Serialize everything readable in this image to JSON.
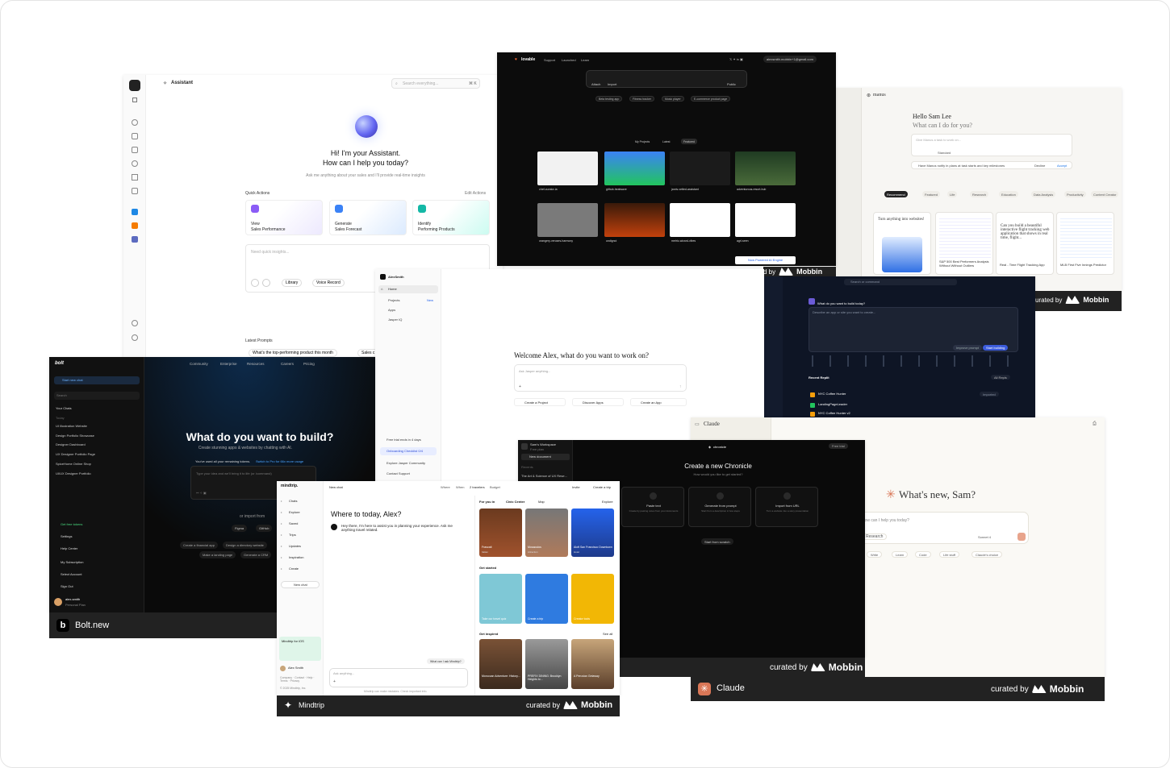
{
  "assistant": {
    "title": "Assistant",
    "search_placeholder": "Search everything...",
    "shortcut": "⌘ K",
    "greeting_line1": "Hi! I'm your Assistant.",
    "greeting_line2": "How can I help you today?",
    "subtitle": "Ask me anything about your sales and I'll provide real-time insights",
    "quick_actions_label": "Quick Actions",
    "edit_actions": "Edit Actions",
    "actions": [
      {
        "line1": "View",
        "line2": "Sales Performance"
      },
      {
        "line1": "Generate",
        "line2": "Sales Forecast"
      },
      {
        "line1": "Identify",
        "line2": "Performing Products"
      }
    ],
    "input_placeholder": "Need quick insights...",
    "library_label": "Library",
    "voice_label": "Voice Record",
    "latest_prompts_label": "Latest Prompts",
    "prompt_1": "What's the top-performing product this month",
    "prompt_2": "Sales c"
  },
  "lovable": {
    "brand": "lovable",
    "nav": [
      "Support",
      "Launched",
      "Learn"
    ],
    "email": "alexsmith.mobbin+1@gmail.com",
    "attach": "Attach",
    "import": "Import",
    "public": "Public",
    "suggestions": [
      "Beta testing app",
      "Fitness tracker",
      "Music player",
      "E-commerce product page"
    ],
    "tabs": [
      "My Projects",
      "Latest",
      "Featured"
    ],
    "projects_row1": [
      "chef-curator-ia",
      "github-heatwave",
      "jarvis-vetted-assistant",
      "adventurous-resort-hub"
    ],
    "projects_row2": [
      "orangery-veruses-harmony",
      "undignoi",
      "metric-wizard-vibes",
      "agri-seen"
    ],
    "more_label": "Now Powered AI Engine"
  },
  "manus": {
    "brand": "manus",
    "hello": "Hello Sam Lee",
    "question": "What can I do for you?",
    "input_placeholder": "Give Manus a task to work on...",
    "standard": "Standard",
    "suggestion": "Have Manus notify in plans at task starts and key milestones",
    "decline": "Decline",
    "accept": "Accept",
    "tabs": [
      "Recommend",
      "Featured",
      "Life",
      "Research",
      "Education",
      "Data Analysis",
      "Productivity",
      "Content Creator"
    ],
    "card1": "Turn anything into websites!",
    "card3": "Can you build a beautiful interactive flight tracking web application that shows in real time, flight...",
    "cap1": "S&P 500 Best Performers Analysis Without Without Outliers",
    "cap2": "Real - Time Flight Tracking App",
    "cap3": "MLB First Five Innings Predictor"
  },
  "jasper": {
    "user": "AlexSmith",
    "nav": [
      "Home",
      "Projects",
      "Apps",
      "Jasper IQ"
    ],
    "new_badge": "New",
    "welcome": "Welcome Alex, what do you want to work on?",
    "input_placeholder": "Ask Jasper anything...",
    "create_project": "Create a Project",
    "discover_apps": "Discover Apps",
    "create_app": "Create an App",
    "trial": "Free trial ends in 4 days",
    "checklist": "Onboarding Checklist 0/4",
    "explore": "Explore Jasper Community",
    "contact": "Contact Support"
  },
  "darkapp": {
    "search": "Search or command",
    "heading": "What do you want to build today?",
    "prompt": "Describe an app or site you want to create...",
    "improve": "Improve prompt",
    "start": "Start building",
    "recent_label": "Recent Replit",
    "recent_badge": "All Repls",
    "items": [
      "NYC Coffee Hunter",
      "LandingPageLeader",
      "NYC Coffee Hunter v2"
    ],
    "imported": "Imported"
  },
  "bolt": {
    "brand": "bolt",
    "start_chat": "Start new chat",
    "search": "Search",
    "your_chats": "Your Chats",
    "today": "Today",
    "chats": [
      "UI Illustration Website",
      "Design Portfolio Showcase",
      "Designer Dashboard",
      "UX Designer Portfolio Page",
      "SpiceHome Online Shop",
      "UI/UX Designer Portfolio"
    ],
    "nav": [
      "Community",
      "Enterprise",
      "Resources",
      "Careers",
      "Pricing"
    ],
    "heading": "What do you want to build?",
    "subheading": "Create stunning apps & websites by chatting with AI.",
    "tokens_notice": "You've used all your remaining tokens.",
    "tokens_link": "Switch to Pro for 66x more usage",
    "input_placeholder": "Type your idea and we'll bring it to life (or /command)",
    "import_from": "or import from",
    "figma": "Figma",
    "github": "GitHub",
    "suggestions": [
      "Create a financial app",
      "Design a directory website",
      "Make a landing page",
      "Generate a CRM"
    ],
    "menu": [
      "Get free tokens",
      "Settings",
      "Help Center",
      "My Subscription",
      "Select Account",
      "Sign Out"
    ],
    "user_name": "alex-smith",
    "user_plan": "Personal Plan",
    "footer": "Bolt.new"
  },
  "mindtrip": {
    "brand": "mindtrip.",
    "new_chat_title": "New chat",
    "filters": [
      "Where",
      "When",
      "2 travelers",
      "Budget"
    ],
    "invite": "Invite",
    "create_trip": "Create a trip",
    "nav": [
      "Chats",
      "Explore",
      "Saved",
      "Trips",
      "Updates",
      "Inspiration",
      "Create"
    ],
    "new_chat": "New chat",
    "heading": "Where to today, Alex?",
    "message": "Hey there, I'm here to assist you in planning your experience. Ask me anything travel related.",
    "ask_placeholder": "Ask anything...",
    "what_can": "What can I ask Mindtrip?",
    "disclaimer": "Mindtrip can make mistakes. Check important info.",
    "for_you": "For you in",
    "location": "Civic Center",
    "map": "Map",
    "explore": "Explore",
    "get_started": "Get started",
    "get_inspired": "Get inspired",
    "see_all": "See all",
    "places": [
      {
        "name": "Frascati",
        "sub": "Italian"
      },
      {
        "name": "Mosaoulos",
        "sub": "Attraction"
      },
      {
        "name": "Aloft San Francisco Downtown",
        "sub": "Hotel"
      }
    ],
    "started": [
      "Take our travel quiz",
      "Create a trip",
      "Creator tools"
    ],
    "inspired": [
      "Moroccan Adventure: History...",
      "PREFIX DINING: Brooklyn Heights to...",
      "A Peruvian Getaway"
    ],
    "promo": "Mindtrip for iOS",
    "user_name": "Alex Smith",
    "footer_links": "Company · Contact · Help · Terms · Privacy",
    "copyright": "© 2025 Mindtrip, Inc.",
    "footer": "Mindtrip"
  },
  "chronicle": {
    "workspace": "Sam's Workspace",
    "workspace_sub": "Free plan",
    "new_document": "New document",
    "section": "Recents",
    "doc": "The Art & Science of UX Rese...",
    "brand": "chronicle",
    "free_trial": "Free trial",
    "heading": "Create a new Chronicle",
    "subheading": "How would you like to get started?",
    "options": [
      {
        "title": "Paste text",
        "desc": "Create by pasting notes from your documents"
      },
      {
        "title": "Generate from prompt",
        "desc": "Start from a description in few steps"
      },
      {
        "title": "Import from URL",
        "desc": "Turn a website into a story presentation"
      }
    ],
    "scratch": "Start from scratch"
  },
  "claude": {
    "brand": "Claude",
    "heading": "What's new, Sam?",
    "input_placeholder": "How can I help you today?",
    "research": "Research",
    "model": "Sonnet 4",
    "chips": [
      "Write",
      "Learn",
      "Code",
      "Life stuff",
      "Claude's choice"
    ],
    "footer": "Claude"
  },
  "mobbin": {
    "curated_by": "curated by",
    "brand": "Mobbin",
    "partial_by": "d by"
  }
}
